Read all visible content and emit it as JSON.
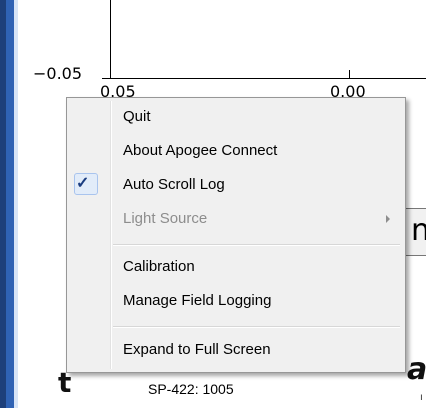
{
  "chart": {
    "y_tick": "−0.05",
    "x_ticks": [
      "0.05",
      "0.00"
    ]
  },
  "background": {
    "button_partial": "n",
    "glyph_left": "t",
    "glyph_right": "a",
    "dot": "ı",
    "device_label": "SP-422: 1005"
  },
  "context_menu": {
    "items": [
      {
        "label": "Quit",
        "checked": false,
        "disabled": false
      },
      {
        "label": "About Apogee Connect",
        "checked": false,
        "disabled": false
      },
      {
        "label": "Auto Scroll Log",
        "checked": true,
        "disabled": false
      },
      {
        "label": "Light Source",
        "checked": false,
        "disabled": true,
        "has_submenu": true
      },
      {
        "label": "Calibration",
        "checked": false,
        "disabled": false
      },
      {
        "label": "Manage Field Logging",
        "checked": false,
        "disabled": false
      },
      {
        "label": "Expand to Full Screen",
        "checked": false,
        "disabled": false
      }
    ],
    "check_icon": "✓"
  }
}
